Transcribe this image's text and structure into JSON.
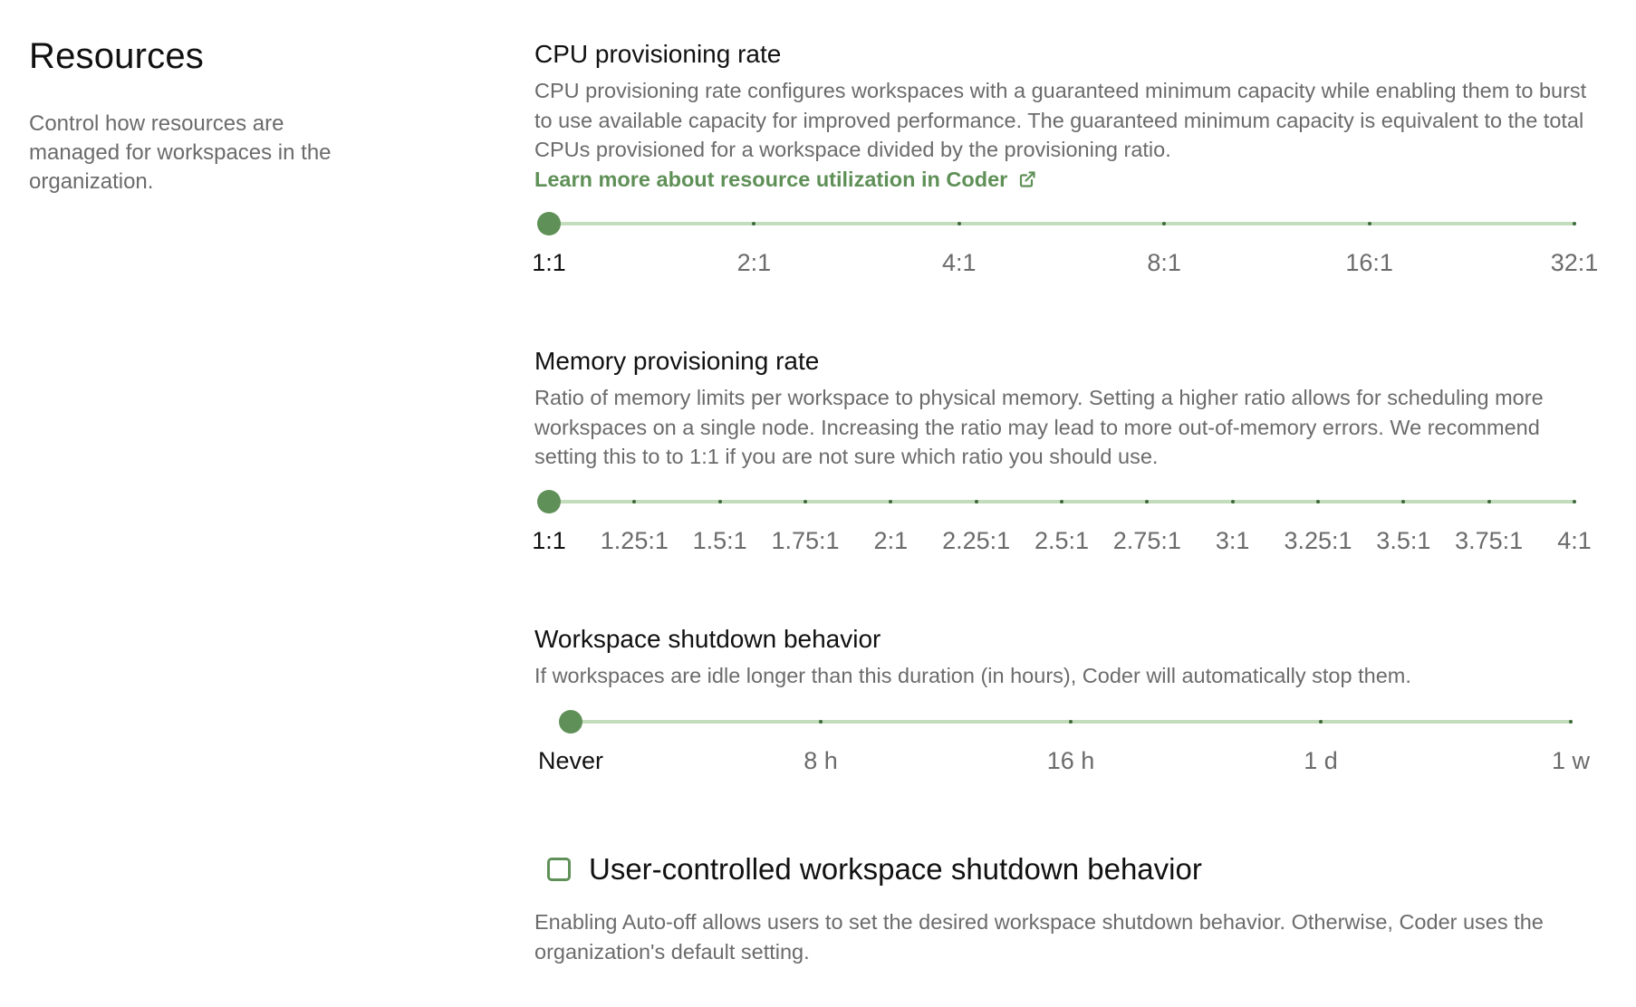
{
  "section": {
    "title": "Resources",
    "description": "Control how resources are managed for workspaces in the organization."
  },
  "cpu": {
    "title": "CPU provisioning rate",
    "description": "CPU provisioning rate configures workspaces with a guaranteed minimum capacity while enabling them to burst to use available capacity for improved performance. The guaranteed minimum capacity is equivalent to the total CPUs provisioned for a workspace divided by the provisioning ratio.",
    "link_label": "Learn more about resource utilization in Coder",
    "link_icon": "external-link-icon",
    "marks": [
      "1:1",
      "2:1",
      "4:1",
      "8:1",
      "16:1",
      "32:1"
    ],
    "selected_index": 0
  },
  "memory": {
    "title": "Memory provisioning rate",
    "description": "Ratio of memory limits per workspace to physical memory. Setting a higher ratio allows for scheduling more workspaces on a single node. Increasing the ratio may lead to more out-of-memory errors. We recommend setting this to to 1:1 if you are not sure which ratio you should use.",
    "marks": [
      "1:1",
      "1.25:1",
      "1.5:1",
      "1.75:1",
      "2:1",
      "2.25:1",
      "2.5:1",
      "2.75:1",
      "3:1",
      "3.25:1",
      "3.5:1",
      "3.75:1",
      "4:1"
    ],
    "selected_index": 0
  },
  "shutdown": {
    "title": "Workspace shutdown behavior",
    "description": "If workspaces are idle longer than this duration (in hours), Coder will automatically stop them.",
    "marks": [
      "Never",
      "8 h",
      "16 h",
      "1 d",
      "1 w"
    ],
    "selected_index": 0
  },
  "user_shutdown": {
    "label": "User-controlled workspace shutdown behavior",
    "checked": false,
    "description": "Enabling Auto-off allows users to set the desired workspace shutdown behavior. Otherwise, Coder uses the organization's default setting."
  },
  "colors": {
    "accent": "#5f9057",
    "track": "#c3dcbc",
    "muted_text": "#6b6b6b"
  }
}
